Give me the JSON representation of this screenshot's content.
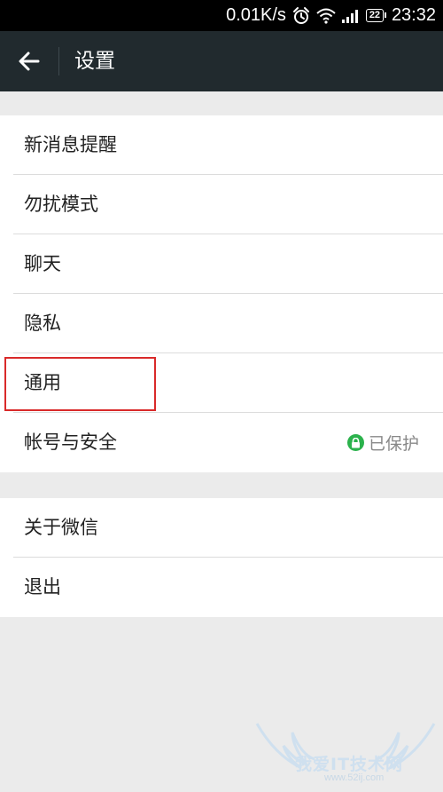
{
  "status_bar": {
    "net_speed": "0.01K/s",
    "battery_level": "22",
    "time": "23:32",
    "icons": [
      "alarm-icon",
      "wifi-icon",
      "signal-icon",
      "battery-icon"
    ]
  },
  "app_bar": {
    "back_icon": "arrow-left-icon",
    "title": "设置"
  },
  "settings": {
    "group1": [
      {
        "label": "新消息提醒"
      },
      {
        "label": "勿扰模式"
      },
      {
        "label": "聊天"
      },
      {
        "label": "隐私"
      },
      {
        "label": "通用"
      },
      {
        "label": "帐号与安全",
        "status": "已保护"
      }
    ],
    "group2": [
      {
        "label": "关于微信"
      },
      {
        "label": "退出"
      }
    ]
  },
  "colors": {
    "app_bar": "#212a2e",
    "background": "#ebebeb",
    "highlight": "#d92a2a",
    "protected_green": "#2bb24c"
  },
  "watermark": {
    "text": "我爱IT技术网",
    "url": "www.52ij.com"
  }
}
